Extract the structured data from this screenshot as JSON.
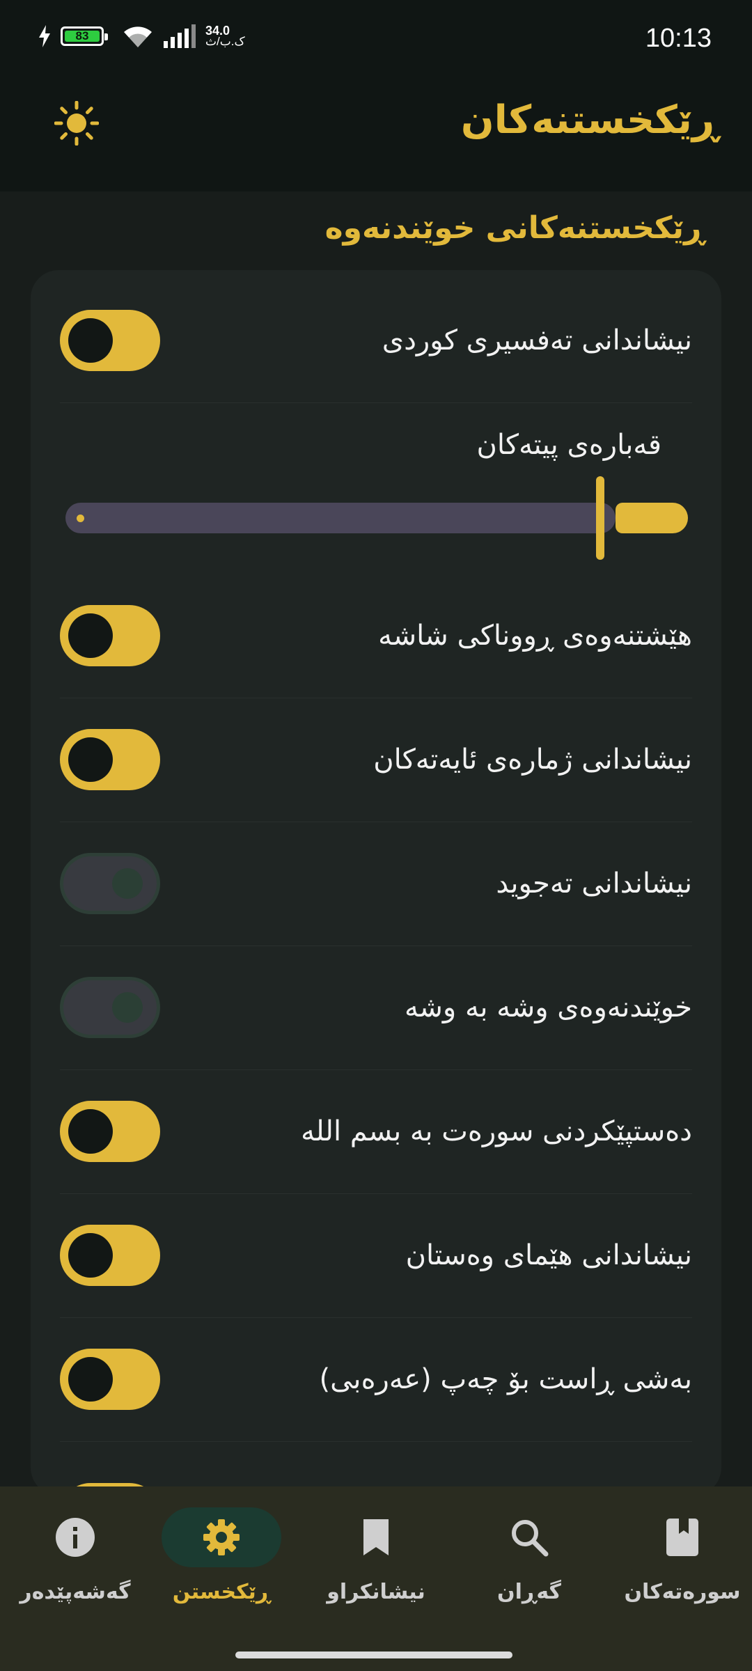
{
  "status_bar": {
    "battery": "83",
    "net_speed_value": "34.0",
    "net_speed_unit": "ک.ب/ث",
    "time": "10:13"
  },
  "app_bar": {
    "title": "ڕێکخستنەکان",
    "theme_icon": "sun-icon"
  },
  "section": {
    "title": "ڕێکخستنەکانی خوێندنەوە"
  },
  "settings": [
    {
      "label": "نیشاندانی تەفسیری کوردی",
      "on": true
    },
    {
      "label": "هێشتنەوەی ڕووناکی شاشە",
      "on": true
    },
    {
      "label": "نیشاندانی ژمارەی ئایەتەکان",
      "on": true
    },
    {
      "label": "نیشاندانی تەجوید",
      "on": false
    },
    {
      "label": "خوێندنەوەی وشە بە وشە",
      "on": false
    },
    {
      "label": "دەستپێکردنی سورەت بە بسم الله",
      "on": true
    },
    {
      "label": "نیشاندانی هێمای وەستان",
      "on": true
    },
    {
      "label": "بەشی ڕاست بۆ چەپ (عەرەبی)",
      "on": true
    }
  ],
  "font_size": {
    "label": "قەبارەی پیتەکان",
    "level": 0.9
  },
  "bottom_nav": [
    {
      "label": "گەشەپێدەر",
      "icon": "info-icon",
      "active": false
    },
    {
      "label": "ڕێکخستن",
      "icon": "gear-icon",
      "active": true
    },
    {
      "label": "نیشانکراو",
      "icon": "bookmark-icon",
      "active": false
    },
    {
      "label": "گەڕان",
      "icon": "search-icon",
      "active": false
    },
    {
      "label": "سورەتەکان",
      "icon": "book-icon",
      "active": false
    }
  ],
  "colors": {
    "accent": "#e2b93b",
    "background": "#181d1b",
    "card": "#1f2523",
    "nav_background": "#2a2c20"
  }
}
